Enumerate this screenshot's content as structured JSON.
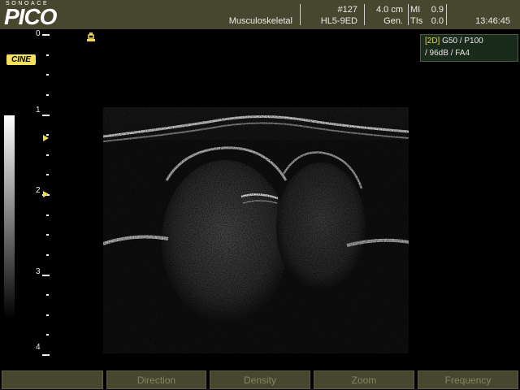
{
  "header": {
    "brand_small": "SONOACE",
    "brand_logo": "PICO",
    "application": "Musculoskeletal",
    "image_number": "#127",
    "probe": "HL5-9ED",
    "depth": "4.0 cm",
    "mode": "Gen.",
    "mi_label": "MI",
    "mi_value": "0.9",
    "tis_label": "TIs",
    "tis_value": "0.0",
    "time": "13:46:45"
  },
  "cine_label": "CINE",
  "imaging_params": {
    "line1_mode": "[2D]",
    "line1_rest": "G50 / P100",
    "line2": "/ 96dB / FA4"
  },
  "depth_ruler": {
    "labels": [
      "0",
      "1",
      "2",
      "3",
      "4"
    ],
    "unit": "cm",
    "focus_depths_cm": [
      1.3,
      2.0
    ]
  },
  "softkeys": [
    "",
    "Direction",
    "Density",
    "Zoom",
    "Frequency"
  ],
  "colors": {
    "header_bg": "#47472f",
    "softkey_bg": "#47472f",
    "softkey_text": "#838363",
    "param_bg": "#1b2b1b",
    "cine_badge": "#f4e05a",
    "focus_marker": "#f3d94b"
  },
  "icons": {
    "probe_orientation": "probe-marker-icon"
  }
}
